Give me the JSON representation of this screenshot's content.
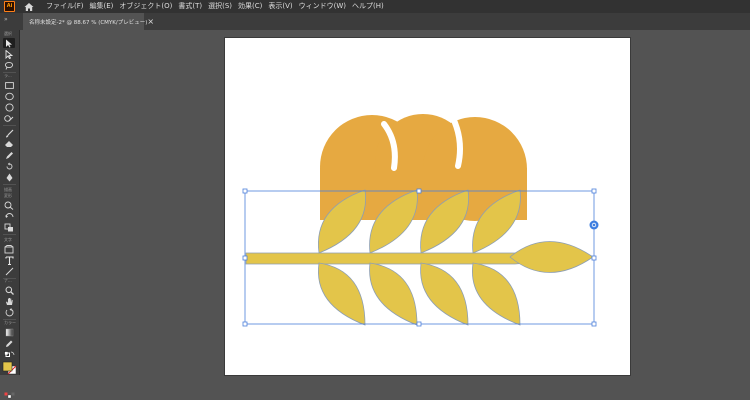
{
  "app": {
    "logo": "Ai"
  },
  "menubar": {
    "items": [
      "ファイル(F)",
      "編集(E)",
      "オブジェクト(O)",
      "書式(T)",
      "選択(S)",
      "効果(C)",
      "表示(V)",
      "ウィンドウ(W)",
      "ヘルプ(H)"
    ]
  },
  "document_tab": {
    "title": "名称未設定-2* @ 88.67 % (CMYK/プレビュー)",
    "close": "×"
  },
  "toolbar": {
    "collapse": "»",
    "group_labels": [
      "選択",
      "ラ...",
      "描画",
      "変形",
      "文字",
      "ナ...",
      "カラー"
    ]
  },
  "colors": {
    "bread": "#E6A941",
    "leaf": "#E3C54A",
    "leaf_stroke": "#8E9FB2",
    "selection": "#4C7FDB",
    "fill_swatch": "#E3C54A"
  }
}
